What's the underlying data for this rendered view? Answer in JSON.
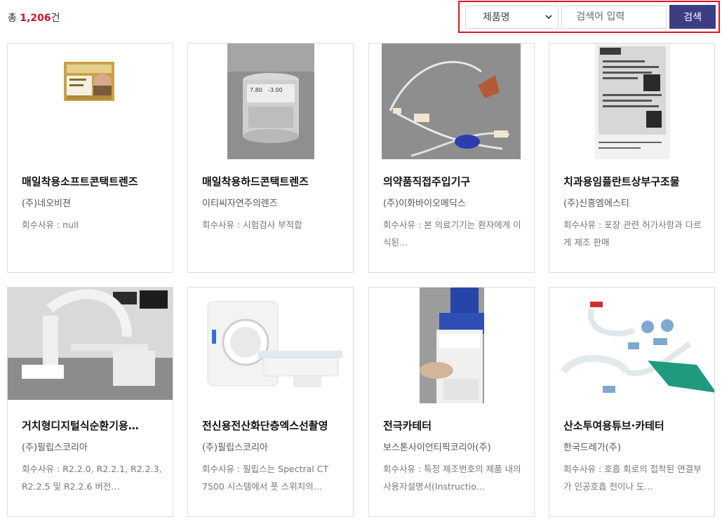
{
  "header": {
    "total_prefix": "총",
    "total_count": "1,206",
    "total_suffix": "건"
  },
  "search": {
    "select_value": "제품명",
    "placeholder": "검색어 입력",
    "button_label": "검색"
  },
  "products": [
    {
      "title": "매일착용소프트콘택트렌즈",
      "company": "(주)네오비젼",
      "reason": "회수사유 : null",
      "image": "contact-lens-box-photo"
    },
    {
      "title": "매일착용하드콘택트렌즈",
      "company": "이티씨자연주의렌즈",
      "reason": "회수사유 : 시험검사 부적합",
      "image": "lens-vial-photo",
      "image_text": {
        "line1": "7.80",
        "line2": "-3.00"
      }
    },
    {
      "title": "의약품직접주입기구",
      "company": "(주)이화바이오메딕스",
      "reason": "회수사유 : 본 의료기기는 환자에게 이식된…",
      "image": "infusion-set-photo"
    },
    {
      "title": "치과용임플란트상부구조물",
      "company": "(주)신흥엠에스티",
      "reason": "회수사유 : 포장 관련 허가사항과 다르게 제조 판매",
      "image": "label-document-photo"
    },
    {
      "title": "거치형디지털식순환기용…",
      "company": "(주)필립스코리아",
      "reason": "회수사유 : R2.2.0, R2.2.1, R2.2.3, R2.2.5 및 R2.2.6 버전…",
      "image": "angiography-room-photo"
    },
    {
      "title": "전신용전산화단층엑스선촬영",
      "company": "(주)필립스코리아",
      "reason": "회수사유 : 필립스는 Spectral CT 7500 시스템에서 풋 스위치의…",
      "image": "ct-scanner-photo"
    },
    {
      "title": "전극카테터",
      "company": "보스톤사이언티픽코리아(주)",
      "reason": "회수사유 : 특정 제조번호의 제품 내의 사용자설명서(Instructio…",
      "image": "catheter-package-photo"
    },
    {
      "title": "산소투여용튜브·카테터",
      "company": "한국드레가(주)",
      "reason": "회수사유 : 호흡 회로의 접착된 연결부가 인공호흡 전이나 도…",
      "image": "breathing-circuit-photo"
    }
  ],
  "colors": {
    "accent_red": "#d0112b",
    "highlight_border": "#e8101f",
    "button_bg": "#3d3d84"
  }
}
